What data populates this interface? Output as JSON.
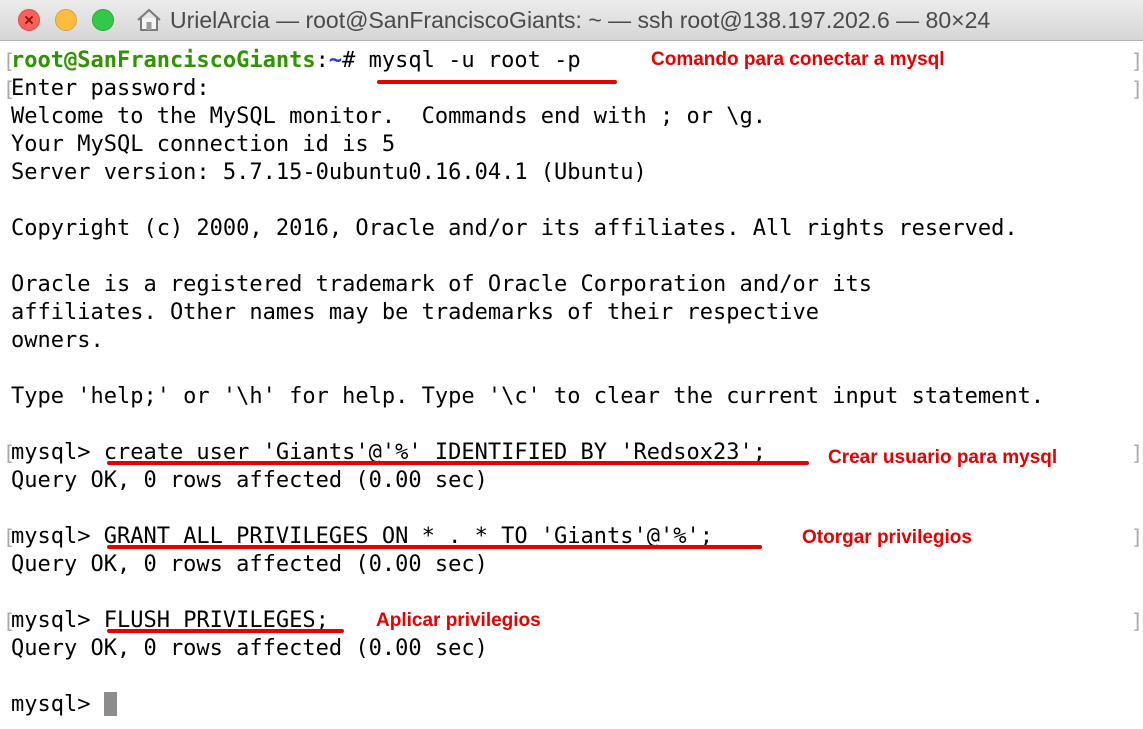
{
  "window": {
    "title": "UrielArcia — root@SanFranciscoGiants: ~ — ssh root@138.197.202.6 — 80×24"
  },
  "terminal": {
    "prompt_user": "root@SanFranciscoGiants",
    "prompt_sep": ":",
    "prompt_path": "~",
    "prompt_hash": "# ",
    "command_1": "mysql -u root -p",
    "lines": {
      "l2": "Enter password:",
      "l3": "Welcome to the MySQL monitor.  Commands end with ; or \\g.",
      "l4": "Your MySQL connection id is 5",
      "l5": "Server version: 5.7.15-0ubuntu0.16.04.1 (Ubuntu)",
      "l7": "Copyright (c) 2000, 2016, Oracle and/or its affiliates. All rights reserved.",
      "l9": "Oracle is a registered trademark of Oracle Corporation and/or its",
      "l10": "affiliates. Other names may be trademarks of their respective",
      "l11": "owners.",
      "l13": "Type 'help;' or '\\h' for help. Type '\\c' to clear the current input statement."
    },
    "mysql_prompt": "mysql> ",
    "cmd_create": "create user 'Giants'@'%' IDENTIFIED BY 'Redsox23';",
    "cmd_grant": "GRANT ALL PRIVILEGES ON * . * TO 'Giants'@'%';",
    "cmd_flush": "FLUSH PRIVILEGES;",
    "query_ok": "Query OK, 0 rows affected (0.00 sec)"
  },
  "annotations": {
    "connect": "Comando para conectar a mysql",
    "create": "Crear usuario para mysql",
    "grant": "Otorgar privilegios",
    "flush": "Aplicar privilegios"
  },
  "colors": {
    "annotation_red": "#e60000",
    "prompt_green": "#2f9400",
    "prompt_blue": "#1c3fc8"
  }
}
